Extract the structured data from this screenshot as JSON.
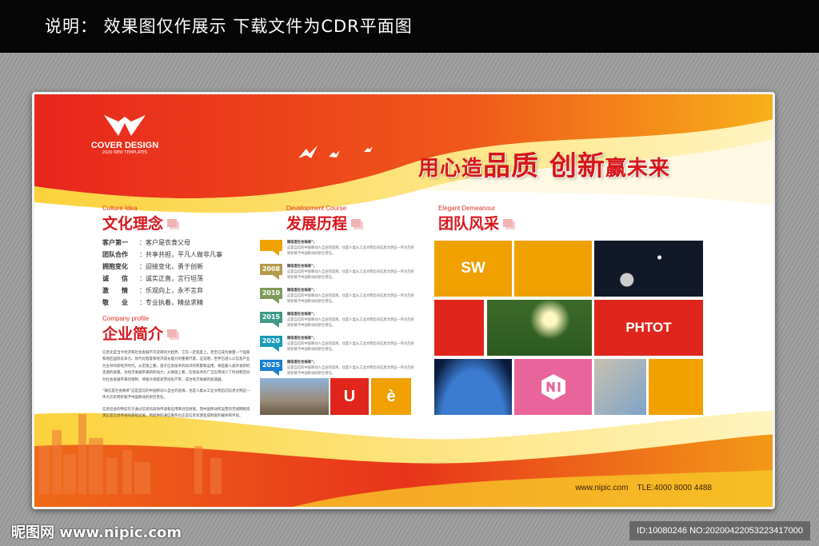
{
  "caption": "说明： 效果图仅作展示  下载文件为CDR平面图",
  "logo": {
    "name": "COVER DESIGN",
    "sub": "2020 NEW TEMPLATES"
  },
  "headline": {
    "part1": "用心造",
    "part2": "品质",
    "part3": "创新",
    "part4": "赢未来"
  },
  "culture": {
    "en": "Culture Idea",
    "title": "文化理念",
    "values": [
      {
        "k": "客户第一",
        "v": "：客户是衣食父母"
      },
      {
        "k": "团队合作",
        "v": "：共享共担，平凡人做非凡事"
      },
      {
        "k": "拥抱变化",
        "v": "：迎接变化，勇于创新"
      },
      {
        "k": "诚　　信",
        "v": "：诚实正直，言行坦荡"
      },
      {
        "k": "激　　情",
        "v": "：乐观向上，永不言弃"
      },
      {
        "k": "敬　　业",
        "v": "：专业执着，精益求精"
      }
    ]
  },
  "profile": {
    "en": "Company profile",
    "title": "企业简介",
    "p1": "信息化是当今经济和社会发展不可逆转的大趋势，它在一定程度上，甚至已成为衡量一个国家和地区国际竞争力、现代化程度和经济成长能力的重要尺度。这说明，世界已进入以信息产业为主导的新经济时代。从宏观上看，基于信息技术的知识的积累和运用，将是最人类开发新的资源的质量，为经济发展带来新的动力；从微观上看，信息技术的广泛应用减少了时间和空间对社会发展带来的限制，将极大地提高劳动生产率，成为经济发展的加速器。",
    "p2": "“微信是社会株梁”这是自信的中国移动人自主的选择，也是人类从工业文明迈向信息文明这一伟大历史转折赋予中国移动的崇巨责任。",
    "p3": "信息社会的特征在于通过信息的高效传递和应用来创造财富，而中国移动所运营的无线网络资源正是信息传递的基础设施，所提供的通信服务也正是信息资源变成财富的载体和手段。"
  },
  "development": {
    "en": "Development Course",
    "title": "发展历程",
    "items": [
      {
        "year": "",
        "head": "微信是社会株梁”，",
        "body": "这是自信的中国移动人自主的选择，也是人类从工业文明迈向信息文明这一伟大历史转折赋予中国移动的崇巨责任。"
      },
      {
        "year": "2008",
        "head": "微信是社会株梁”，",
        "body": "这是自信的中国移动人自主的选择，也是人类从工业文明迈向信息文明这一伟大历史转折赋予中国移动的崇巨责任。"
      },
      {
        "year": "2010",
        "head": "微信是社会株梁”，",
        "body": "这是自信的中国移动人自主的选择，也是人类从工业文明迈向信息文明这一伟大历史转折赋予中国移动的崇巨责任。"
      },
      {
        "year": "2015",
        "head": "微信是社会株梁”，",
        "body": "这是自信的中国移动人自主的选择，也是人类从工业文明迈向信息文明这一伟大历史转折赋予中国移动的崇巨责任。"
      },
      {
        "year": "2020",
        "head": "微信是社会株梁”，",
        "body": "这是自信的中国移动人自主的选择，也是人类从工业文明迈向信息文明这一伟大历史转折赋予中国移动的崇巨责任。"
      },
      {
        "year": "2025",
        "head": "微信是社会株梁”，",
        "body": "这是自信的中国移动人自主的选择，也是人类从工业文明迈向信息文明这一伟大历史转折赋予中国移动的崇巨责任。"
      }
    ],
    "tile_u": "U",
    "tile_e": "è"
  },
  "team": {
    "en": "Elegant Demeanour",
    "title": "团队风采",
    "tile1": "SW",
    "tile2": "PHTOT"
  },
  "footer": {
    "url": "www.nipic.com",
    "tel": "TLE:4000 8000 4488"
  },
  "watermark": "昵图网 www.nipic.com",
  "image_id": "ID:10080246 NO:20200422053223417000",
  "colors": {
    "red": "#d8161b",
    "orange": "#f0a000",
    "pink": "#e8649a"
  }
}
